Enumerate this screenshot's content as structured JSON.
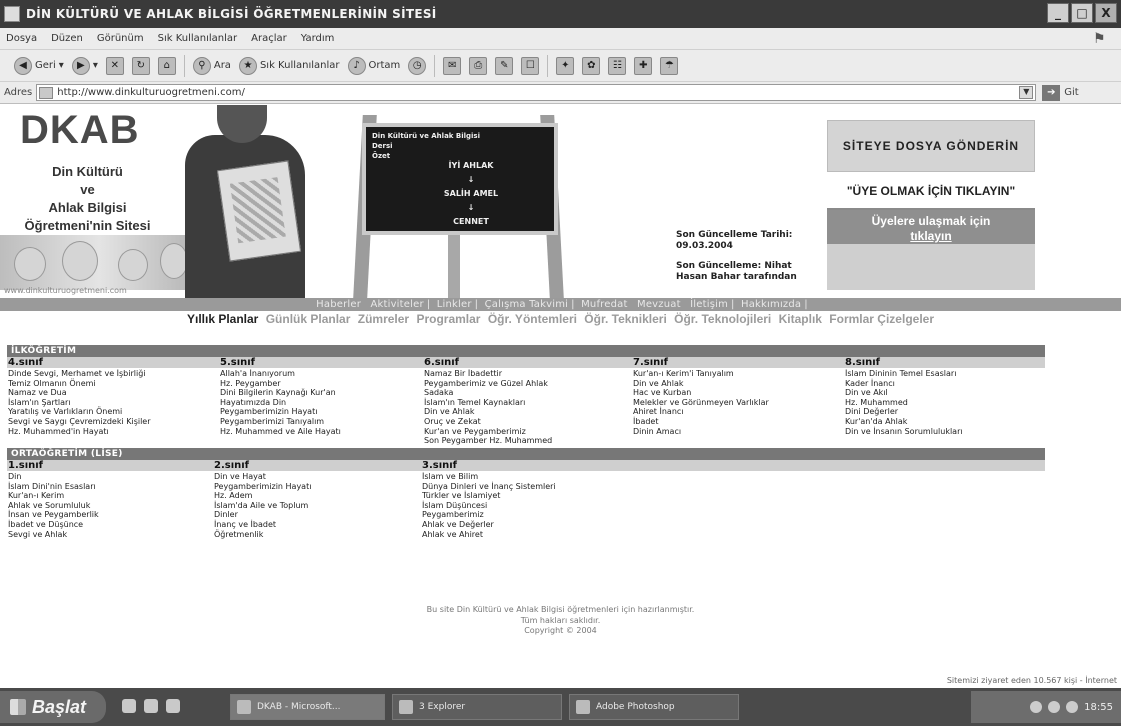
{
  "window": {
    "title": "DİN KÜLTÜRÜ VE AHLAK BİLGİSİ ÖĞRETMENLERİNİN SİTESİ",
    "controls": [
      "_",
      "□",
      "X"
    ]
  },
  "menu": [
    "Dosya",
    "Düzen",
    "Görünüm",
    "Sık Kullanılanlar",
    "Araçlar",
    "Yardım"
  ],
  "toolbar": {
    "back": "Geri",
    "search": "Ara",
    "favorites": "Sık Kullanılanlar",
    "media": "Ortam"
  },
  "address": {
    "label": "Adres",
    "url": "http://www.dinkulturuogretmeni.com/",
    "go": "Git"
  },
  "logo": {
    "title": "DKAB",
    "line1": "Din Kültürü",
    "line2": "ve",
    "line3": "Ahlak Bilgisi",
    "line4": "Öğretmeni'nin Sitesi",
    "url": "www.dinkulturuogretmeni.com"
  },
  "board": {
    "heading": "Din Kültürü ve Ahlak Bilgisi",
    "line2": "Dersi",
    "line3": "Özet",
    "steps": [
      "İYİ AHLAK",
      "↓",
      "SALİH AMEL",
      "↓",
      "CENNET"
    ]
  },
  "update": {
    "date_label": "Son Güncelleme Tarihi:",
    "date_value": "09.03.2004",
    "by_label": "Son Güncelleme: Nihat",
    "by_value": "Hasan Bahar tarafından"
  },
  "right": {
    "send": "SİTEYE DOSYA GÖNDERİN",
    "member": "\"ÜYE OLMAK İÇİN TIKLAYIN\"",
    "contact_line1": "Üyelere ulaşmak için",
    "contact_link": "tıklayın"
  },
  "nav1": [
    "Haberler",
    "Aktiviteler",
    "Linkler",
    "Çalışma Takvimi",
    "Mufredat",
    "Mevzuat",
    "İletişim",
    "Hakkımızda"
  ],
  "nav2": [
    "Yıllık Planlar",
    "Günlük Planlar",
    "Zümreler",
    "Programlar",
    "Öğr. Yöntemleri",
    "Öğr. Teknikleri",
    "Öğr. Teknolojileri",
    "Kitaplık",
    "Formlar Çizelgeler"
  ],
  "ilkogretim": {
    "title": "İLKÖĞRETİM",
    "columns": [
      {
        "grade": "4.sınıf",
        "items": [
          "Dinde Sevgi, Merhamet ve İşbirliği",
          "Temiz Olmanın Önemi",
          "Namaz ve Dua",
          "İslam'ın Şartları",
          "Yaratılış ve Varlıkların Önemi",
          "Sevgi ve Saygı Çevremizdeki Kişiler",
          "Hz. Muhammed'in Hayatı"
        ]
      },
      {
        "grade": "5.sınıf",
        "items": [
          "Allah'a İnanıyorum",
          "Hz. Peygamber",
          "Dini Bilgilerin Kaynağı Kur'an",
          "Hayatımızda Din",
          "Peygamberimizin Hayatı",
          "Peygamberimizi Tanıyalım",
          "Hz. Muhammed ve Aile Hayatı"
        ]
      },
      {
        "grade": "6.sınıf",
        "items": [
          "Namaz Bir İbadettir",
          "Peygamberimiz ve Güzel Ahlak",
          "Sadaka",
          "İslam'ın Temel Kaynakları",
          "Din ve Ahlak",
          "Oruç ve Zekat",
          "Kur'an ve Peygamberimiz",
          "Son Peygamber Hz. Muhammed"
        ]
      },
      {
        "grade": "7.sınıf",
        "items": [
          "Kur'an-ı Kerim'i Tanıyalım",
          "Din ve Ahlak",
          "Hac ve Kurban",
          "Melekler ve Görünmeyen Varlıklar",
          "Ahiret İnancı",
          "İbadet",
          "Dinin Amacı"
        ]
      },
      {
        "grade": "8.sınıf",
        "items": [
          "İslam Dininin Temel Esasları",
          "Kader İnancı",
          "Din ve Akıl",
          "Hz. Muhammed",
          "Dini Değerler",
          "Kur'an'da Ahlak",
          "Din ve İnsanın Sorumlulukları"
        ]
      }
    ]
  },
  "ortaogretim": {
    "title": "ORTAÖĞRETİM (LİSE)",
    "columns": [
      {
        "grade": "1.sınıf",
        "items": [
          "Din",
          "İslam Dini'nin Esasları",
          "Kur'an-ı Kerim",
          "Ahlak ve Sorumluluk",
          "İnsan ve Peygamberlik",
          "İbadet ve Düşünce",
          "Sevgi ve Ahlak"
        ]
      },
      {
        "grade": "2.sınıf",
        "items": [
          "Din ve Hayat",
          "Peygamberimizin Hayatı",
          "Hz. Adem",
          "İslam'da Aile ve Toplum",
          "Dinler",
          "İnanç ve İbadet",
          "Öğretmenlik"
        ]
      },
      {
        "grade": "3.sınıf",
        "items": [
          "İslam ve Bilim",
          "Dünya Dinleri ve İnanç Sistemleri",
          "Türkler ve İslamiyet",
          "İslam Düşüncesi",
          "Peygamberimiz",
          "Ahlak ve Değerler",
          "Ahlak ve Ahiret"
        ]
      }
    ]
  },
  "footer": [
    "Bu site Din Kültürü ve Ahlak Bilgisi öğretmenleri için hazırlanmıştır.",
    "Tüm hakları saklıdır.",
    "Copyright © 2004"
  ],
  "status": {
    "text": "Sitemizi ziyaret eden 10.567 kişi - İnternet"
  },
  "taskbar": {
    "start": "Başlat",
    "tasks": [
      "DKAB - Microsoft...",
      "3 Explorer",
      "Adobe Photoshop"
    ],
    "clock": "18:55"
  }
}
